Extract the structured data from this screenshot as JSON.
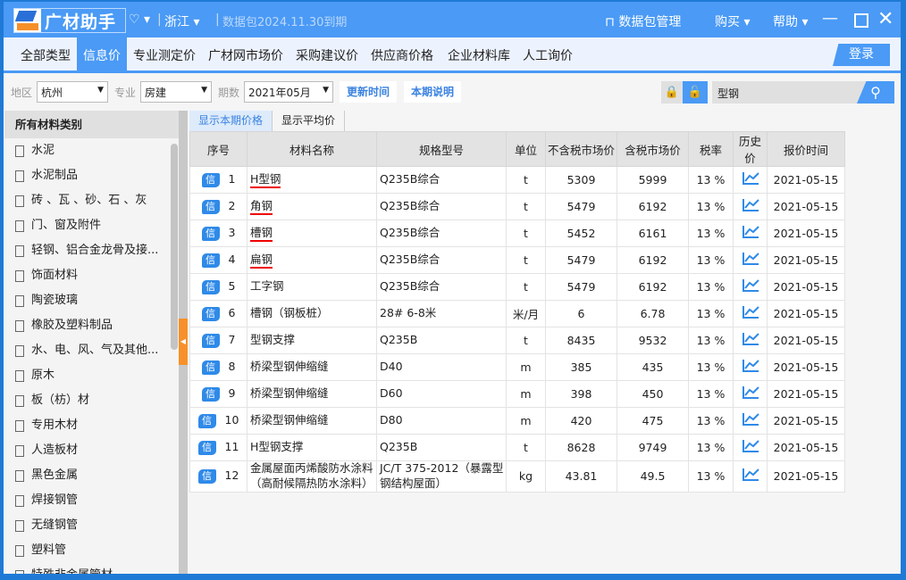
{
  "title": {
    "logo": "广材助手",
    "region": "浙江",
    "expiry": "数据包2024.11.30到期",
    "pkg_mgr": "数据包管理",
    "buy": "购买",
    "help": "帮助"
  },
  "nav": {
    "items": [
      "全部类型",
      "信息价",
      "专业测定价",
      "广材网市场价",
      "采购建议价",
      "供应商价格",
      "企业材料库",
      "人工询价"
    ],
    "active": 1,
    "login": "登录"
  },
  "filter": {
    "area_label": "地区",
    "area": "杭州",
    "major_label": "专业",
    "major": "房建",
    "period_label": "期数",
    "period": "2021年05月",
    "update_btn": "更新时间",
    "note_btn": "本期说明",
    "search_value": "型钢"
  },
  "sidebar": {
    "header": "所有材料类别",
    "items": [
      "水泥",
      "水泥制品",
      "砖 、瓦 、砂、石 、灰",
      "门、窗及附件",
      "轻钢、铝合金龙骨及接...",
      "饰面材料",
      "陶瓷玻璃",
      "橡胶及塑料制品",
      "水、电、风、气及其他...",
      "原木",
      "板（枋）材",
      "专用木材",
      "人造板材",
      "黑色金属",
      "焊接钢管",
      "无缝钢管",
      "塑料管",
      "特殊非金属管材"
    ]
  },
  "tabs": [
    "显示本期价格",
    "显示平均价"
  ],
  "table": {
    "columns": [
      "序号",
      "材料名称",
      "规格型号",
      "单位",
      "不含税市场价",
      "含税市场价",
      "税率",
      "历史价",
      "报价时间"
    ],
    "badge": "信",
    "rows": [
      [
        "1",
        "H型钢",
        "Q235B综合",
        "t",
        "5309",
        "5999",
        "13 %",
        "2021-05-15"
      ],
      [
        "2",
        "角钢",
        "Q235B综合",
        "t",
        "5479",
        "6192",
        "13 %",
        "2021-05-15"
      ],
      [
        "3",
        "槽钢",
        "Q235B综合",
        "t",
        "5452",
        "6161",
        "13 %",
        "2021-05-15"
      ],
      [
        "4",
        "扁钢",
        "Q235B综合",
        "t",
        "5479",
        "6192",
        "13 %",
        "2021-05-15"
      ],
      [
        "5",
        "工字钢",
        "Q235B综合",
        "t",
        "5479",
        "6192",
        "13 %",
        "2021-05-15"
      ],
      [
        "6",
        "槽钢（钢板桩）",
        "28# 6-8米",
        "米/月",
        "6",
        "6.78",
        "13 %",
        "2021-05-15"
      ],
      [
        "7",
        "型钢支撑",
        "Q235B",
        "t",
        "8435",
        "9532",
        "13 %",
        "2021-05-15"
      ],
      [
        "8",
        "桥梁型钢伸缩缝",
        "D40",
        "m",
        "385",
        "435",
        "13 %",
        "2021-05-15"
      ],
      [
        "9",
        "桥梁型钢伸缩缝",
        "D60",
        "m",
        "398",
        "450",
        "13 %",
        "2021-05-15"
      ],
      [
        "10",
        "桥梁型钢伸缩缝",
        "D80",
        "m",
        "420",
        "475",
        "13 %",
        "2021-05-15"
      ],
      [
        "11",
        "H型钢支撑",
        "Q235B",
        "t",
        "8628",
        "9749",
        "13 %",
        "2021-05-15"
      ],
      [
        "12",
        "金属屋面丙烯酸防水涂料（高耐候隔热防水涂料）",
        "JC/T 375-2012（暴露型钢结构屋面）",
        "kg",
        "43.81",
        "49.5",
        "13 %",
        "2021-05-15"
      ]
    ]
  }
}
